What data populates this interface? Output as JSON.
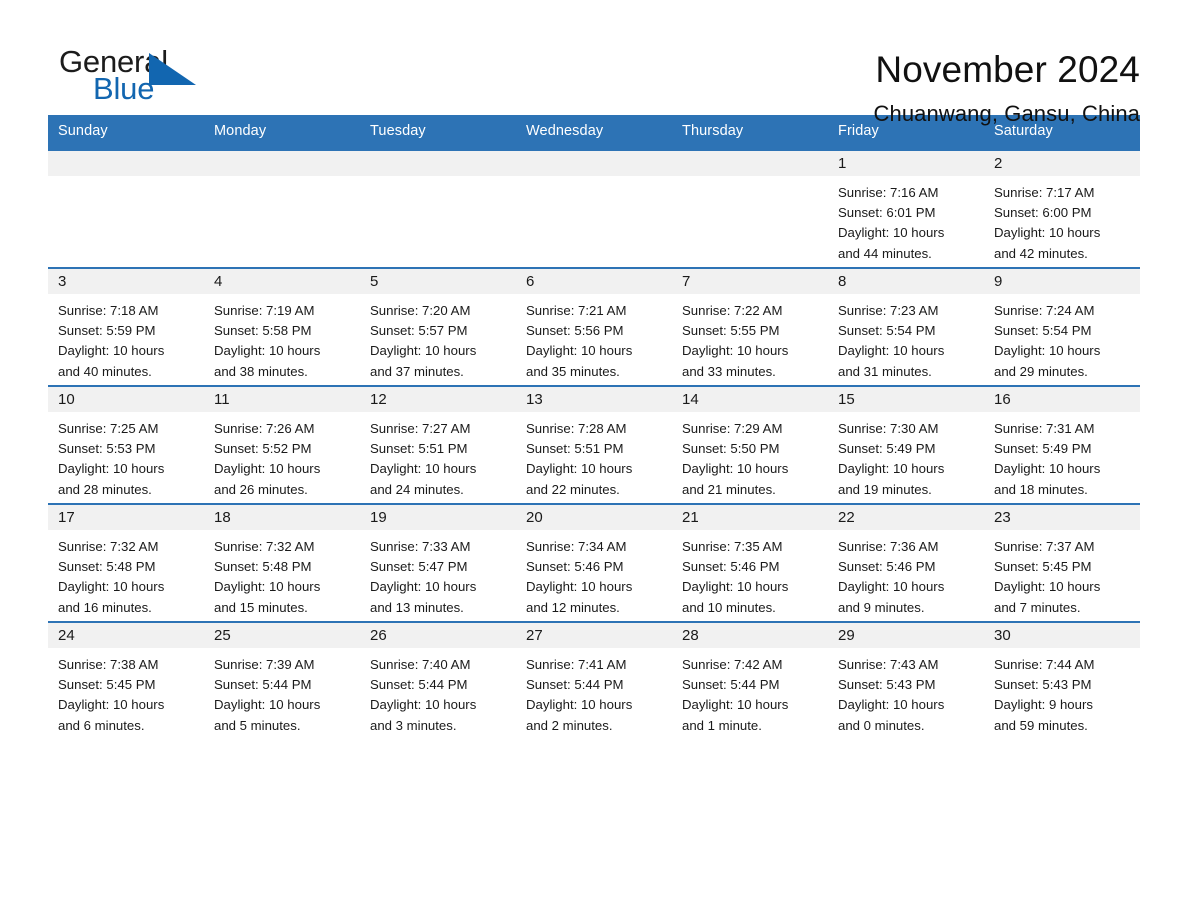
{
  "brand": {
    "name_part1": "General",
    "name_part2": "Blue",
    "flag_icon": "blue-triangle-flag-icon",
    "flag_color": "#1266b0"
  },
  "header": {
    "title": "November 2024",
    "location": "Chuanwang, Gansu, China"
  },
  "theme": {
    "header_blue": "#2d73b5",
    "day_band_gray": "#f1f1f1",
    "text": "#1a1a1a"
  },
  "weekdays": [
    "Sunday",
    "Monday",
    "Tuesday",
    "Wednesday",
    "Thursday",
    "Friday",
    "Saturday"
  ],
  "weeks": [
    [
      {
        "day": "",
        "sunrise": "",
        "sunset": "",
        "daylight1": "",
        "daylight2": ""
      },
      {
        "day": "",
        "sunrise": "",
        "sunset": "",
        "daylight1": "",
        "daylight2": ""
      },
      {
        "day": "",
        "sunrise": "",
        "sunset": "",
        "daylight1": "",
        "daylight2": ""
      },
      {
        "day": "",
        "sunrise": "",
        "sunset": "",
        "daylight1": "",
        "daylight2": ""
      },
      {
        "day": "",
        "sunrise": "",
        "sunset": "",
        "daylight1": "",
        "daylight2": ""
      },
      {
        "day": "1",
        "sunrise": "Sunrise: 7:16 AM",
        "sunset": "Sunset: 6:01 PM",
        "daylight1": "Daylight: 10 hours",
        "daylight2": "and 44 minutes."
      },
      {
        "day": "2",
        "sunrise": "Sunrise: 7:17 AM",
        "sunset": "Sunset: 6:00 PM",
        "daylight1": "Daylight: 10 hours",
        "daylight2": "and 42 minutes."
      }
    ],
    [
      {
        "day": "3",
        "sunrise": "Sunrise: 7:18 AM",
        "sunset": "Sunset: 5:59 PM",
        "daylight1": "Daylight: 10 hours",
        "daylight2": "and 40 minutes."
      },
      {
        "day": "4",
        "sunrise": "Sunrise: 7:19 AM",
        "sunset": "Sunset: 5:58 PM",
        "daylight1": "Daylight: 10 hours",
        "daylight2": "and 38 minutes."
      },
      {
        "day": "5",
        "sunrise": "Sunrise: 7:20 AM",
        "sunset": "Sunset: 5:57 PM",
        "daylight1": "Daylight: 10 hours",
        "daylight2": "and 37 minutes."
      },
      {
        "day": "6",
        "sunrise": "Sunrise: 7:21 AM",
        "sunset": "Sunset: 5:56 PM",
        "daylight1": "Daylight: 10 hours",
        "daylight2": "and 35 minutes."
      },
      {
        "day": "7",
        "sunrise": "Sunrise: 7:22 AM",
        "sunset": "Sunset: 5:55 PM",
        "daylight1": "Daylight: 10 hours",
        "daylight2": "and 33 minutes."
      },
      {
        "day": "8",
        "sunrise": "Sunrise: 7:23 AM",
        "sunset": "Sunset: 5:54 PM",
        "daylight1": "Daylight: 10 hours",
        "daylight2": "and 31 minutes."
      },
      {
        "day": "9",
        "sunrise": "Sunrise: 7:24 AM",
        "sunset": "Sunset: 5:54 PM",
        "daylight1": "Daylight: 10 hours",
        "daylight2": "and 29 minutes."
      }
    ],
    [
      {
        "day": "10",
        "sunrise": "Sunrise: 7:25 AM",
        "sunset": "Sunset: 5:53 PM",
        "daylight1": "Daylight: 10 hours",
        "daylight2": "and 28 minutes."
      },
      {
        "day": "11",
        "sunrise": "Sunrise: 7:26 AM",
        "sunset": "Sunset: 5:52 PM",
        "daylight1": "Daylight: 10 hours",
        "daylight2": "and 26 minutes."
      },
      {
        "day": "12",
        "sunrise": "Sunrise: 7:27 AM",
        "sunset": "Sunset: 5:51 PM",
        "daylight1": "Daylight: 10 hours",
        "daylight2": "and 24 minutes."
      },
      {
        "day": "13",
        "sunrise": "Sunrise: 7:28 AM",
        "sunset": "Sunset: 5:51 PM",
        "daylight1": "Daylight: 10 hours",
        "daylight2": "and 22 minutes."
      },
      {
        "day": "14",
        "sunrise": "Sunrise: 7:29 AM",
        "sunset": "Sunset: 5:50 PM",
        "daylight1": "Daylight: 10 hours",
        "daylight2": "and 21 minutes."
      },
      {
        "day": "15",
        "sunrise": "Sunrise: 7:30 AM",
        "sunset": "Sunset: 5:49 PM",
        "daylight1": "Daylight: 10 hours",
        "daylight2": "and 19 minutes."
      },
      {
        "day": "16",
        "sunrise": "Sunrise: 7:31 AM",
        "sunset": "Sunset: 5:49 PM",
        "daylight1": "Daylight: 10 hours",
        "daylight2": "and 18 minutes."
      }
    ],
    [
      {
        "day": "17",
        "sunrise": "Sunrise: 7:32 AM",
        "sunset": "Sunset: 5:48 PM",
        "daylight1": "Daylight: 10 hours",
        "daylight2": "and 16 minutes."
      },
      {
        "day": "18",
        "sunrise": "Sunrise: 7:32 AM",
        "sunset": "Sunset: 5:48 PM",
        "daylight1": "Daylight: 10 hours",
        "daylight2": "and 15 minutes."
      },
      {
        "day": "19",
        "sunrise": "Sunrise: 7:33 AM",
        "sunset": "Sunset: 5:47 PM",
        "daylight1": "Daylight: 10 hours",
        "daylight2": "and 13 minutes."
      },
      {
        "day": "20",
        "sunrise": "Sunrise: 7:34 AM",
        "sunset": "Sunset: 5:46 PM",
        "daylight1": "Daylight: 10 hours",
        "daylight2": "and 12 minutes."
      },
      {
        "day": "21",
        "sunrise": "Sunrise: 7:35 AM",
        "sunset": "Sunset: 5:46 PM",
        "daylight1": "Daylight: 10 hours",
        "daylight2": "and 10 minutes."
      },
      {
        "day": "22",
        "sunrise": "Sunrise: 7:36 AM",
        "sunset": "Sunset: 5:46 PM",
        "daylight1": "Daylight: 10 hours",
        "daylight2": "and 9 minutes."
      },
      {
        "day": "23",
        "sunrise": "Sunrise: 7:37 AM",
        "sunset": "Sunset: 5:45 PM",
        "daylight1": "Daylight: 10 hours",
        "daylight2": "and 7 minutes."
      }
    ],
    [
      {
        "day": "24",
        "sunrise": "Sunrise: 7:38 AM",
        "sunset": "Sunset: 5:45 PM",
        "daylight1": "Daylight: 10 hours",
        "daylight2": "and 6 minutes."
      },
      {
        "day": "25",
        "sunrise": "Sunrise: 7:39 AM",
        "sunset": "Sunset: 5:44 PM",
        "daylight1": "Daylight: 10 hours",
        "daylight2": "and 5 minutes."
      },
      {
        "day": "26",
        "sunrise": "Sunrise: 7:40 AM",
        "sunset": "Sunset: 5:44 PM",
        "daylight1": "Daylight: 10 hours",
        "daylight2": "and 3 minutes."
      },
      {
        "day": "27",
        "sunrise": "Sunrise: 7:41 AM",
        "sunset": "Sunset: 5:44 PM",
        "daylight1": "Daylight: 10 hours",
        "daylight2": "and 2 minutes."
      },
      {
        "day": "28",
        "sunrise": "Sunrise: 7:42 AM",
        "sunset": "Sunset: 5:44 PM",
        "daylight1": "Daylight: 10 hours",
        "daylight2": "and 1 minute."
      },
      {
        "day": "29",
        "sunrise": "Sunrise: 7:43 AM",
        "sunset": "Sunset: 5:43 PM",
        "daylight1": "Daylight: 10 hours",
        "daylight2": "and 0 minutes."
      },
      {
        "day": "30",
        "sunrise": "Sunrise: 7:44 AM",
        "sunset": "Sunset: 5:43 PM",
        "daylight1": "Daylight: 9 hours",
        "daylight2": "and 59 minutes."
      }
    ]
  ]
}
